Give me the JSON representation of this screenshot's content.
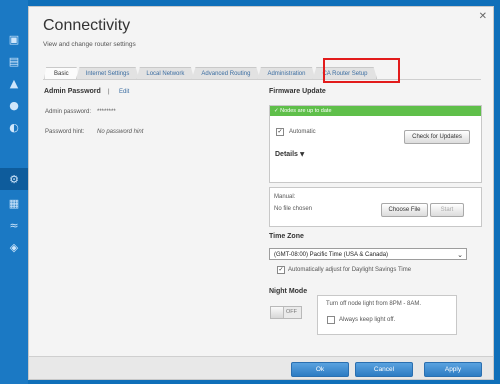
{
  "sidebar": {
    "icons": [
      "network-map-icon",
      "device-list-icon",
      "alert-icon",
      "parental-controls-icon",
      "speed-icon",
      "connectivity-icon",
      "troubleshooting-icon",
      "wireless-icon",
      "security-icon"
    ],
    "active_index": 5
  },
  "header": {
    "title": "Connectivity",
    "subtitle": "View and change router settings"
  },
  "tabs": [
    {
      "label": "Basic",
      "active": true
    },
    {
      "label": "Internet Settings",
      "active": false
    },
    {
      "label": "Local Network",
      "active": false
    },
    {
      "label": "Advanced Routing",
      "active": false
    },
    {
      "label": "Administration",
      "active": false
    },
    {
      "label": "CA Router Setup",
      "active": false
    }
  ],
  "admin": {
    "heading": "Admin Password",
    "separator": "|",
    "edit_link": "Edit",
    "password_label": "Admin password:",
    "password_value": "********",
    "hint_label": "Password hint:",
    "hint_value": "No password hint"
  },
  "firmware": {
    "heading": "Firmware Update",
    "status": "Nodes are up to date",
    "automatic_label": "Automatic",
    "automatic_checked": true,
    "check_button": "Check for Updates",
    "details_label": "Details",
    "manual_label": "Manual:",
    "file_status": "No file chosen",
    "choose_file_button": "Choose File",
    "start_button": "Start"
  },
  "timezone": {
    "heading": "Time Zone",
    "selected": "(GMT-08:00) Pacific Time (USA & Canada)",
    "dst_label": "Automatically adjust for Daylight Savings Time",
    "dst_checked": true
  },
  "night_mode": {
    "heading": "Night Mode",
    "toggle_state": "OFF",
    "description": "Turn off node light from 8PM - 8AM.",
    "always_label": "Always keep light off.",
    "always_checked": false
  },
  "footer": {
    "ok": "Ok",
    "cancel": "Cancel",
    "apply": "Apply"
  },
  "colors": {
    "accent": "#2d7cc3",
    "success": "#5fbf4a",
    "highlight": "#e21b1b",
    "sidebar": "#1b79c4"
  }
}
